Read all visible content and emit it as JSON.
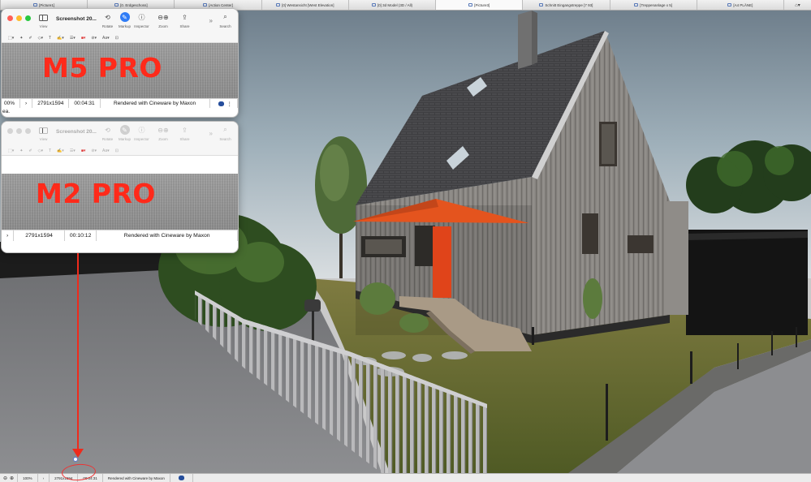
{
  "tabs": [
    {
      "label": "[Picture1]"
    },
    {
      "label": "[0. Erdgeschoss]"
    },
    {
      "label": "[Action Center]"
    },
    {
      "label": "[0] Westansicht [West Elevation]"
    },
    {
      "label": "[0] 3d Model (3D / All)"
    },
    {
      "label": "[Picture3]",
      "active": true
    },
    {
      "label": "Schnitt Eingangstreppe [7 93]"
    },
    {
      "label": "[Treppenanlage x 5]"
    },
    {
      "label": "[A4 PLÄNE]"
    }
  ],
  "windows": [
    {
      "title": "Screenshot 20...",
      "sidebar_label": "View",
      "tools": [
        "Rotate",
        "Markup",
        "Inspector",
        "Zoom",
        "Share"
      ],
      "search_label": "Search",
      "label": "M5 PRO",
      "zoom": "00%",
      "resolution": "2791x1594",
      "render_time": "00:04:31",
      "credit": "Rendered with Cineware by Maxon",
      "extra": "ea."
    },
    {
      "title": "Screenshot 20...",
      "sidebar_label": "View",
      "tools": [
        "Rotate",
        "Markup",
        "Inspector",
        "Zoom",
        "Share"
      ],
      "search_label": "Search",
      "label": "M2 PRO",
      "resolution": "2791x1594",
      "render_time": "00:10:12",
      "credit": "Rendered with Cineware by Maxon"
    }
  ],
  "status": {
    "zoom": "100%",
    "resolution": "2791x1594",
    "render_time": "00:04:31",
    "credit": "Rendered with Cineware by Maxon"
  },
  "colors": {
    "accent_blue": "#2f7cf6",
    "annotation_red": "#ee2b1c",
    "close": "#fe5f57",
    "minimize": "#febc2e",
    "zoom": "#28c840",
    "sail": "#e4541e",
    "door": "#e0441a"
  }
}
